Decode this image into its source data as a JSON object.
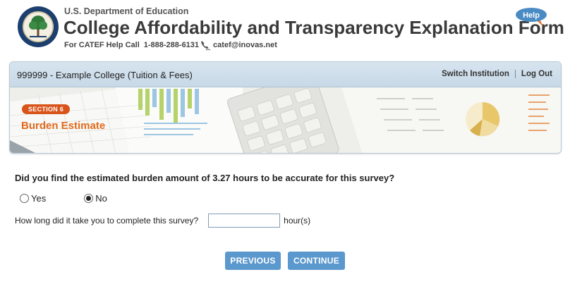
{
  "header": {
    "department": "U.S. Department of Education",
    "title": "College Affordability and Transparency Explanation Form",
    "help_call_prefix": "For CATEF Help Call",
    "help_phone": "1-888-288-6131",
    "help_email": "catef@inovas.net",
    "help_button_label": "Help",
    "seal_icon": "department-of-education-seal"
  },
  "banner": {
    "institution": "999999 - Example College (Tuition & Fees)",
    "switch_institution_label": "Switch Institution",
    "log_out_label": "Log Out",
    "section_badge": "SECTION 6",
    "section_title": "Burden Estimate"
  },
  "form": {
    "question": "Did you find the estimated burden amount of 3.27 hours to be accurate for this survey?",
    "options": [
      {
        "label": "Yes",
        "selected": false
      },
      {
        "label": "No",
        "selected": true
      }
    ],
    "time_question": "How long did it take you to complete this survey?",
    "time_value": "",
    "time_unit": "hour(s)"
  },
  "buttons": {
    "previous_label": "PREVIOUS",
    "continue_label": "CONTINUE"
  },
  "colors": {
    "accent_blue": "#5b98cd",
    "section_orange": "#e06a1c",
    "banner_bar": "#c7d9e7"
  }
}
